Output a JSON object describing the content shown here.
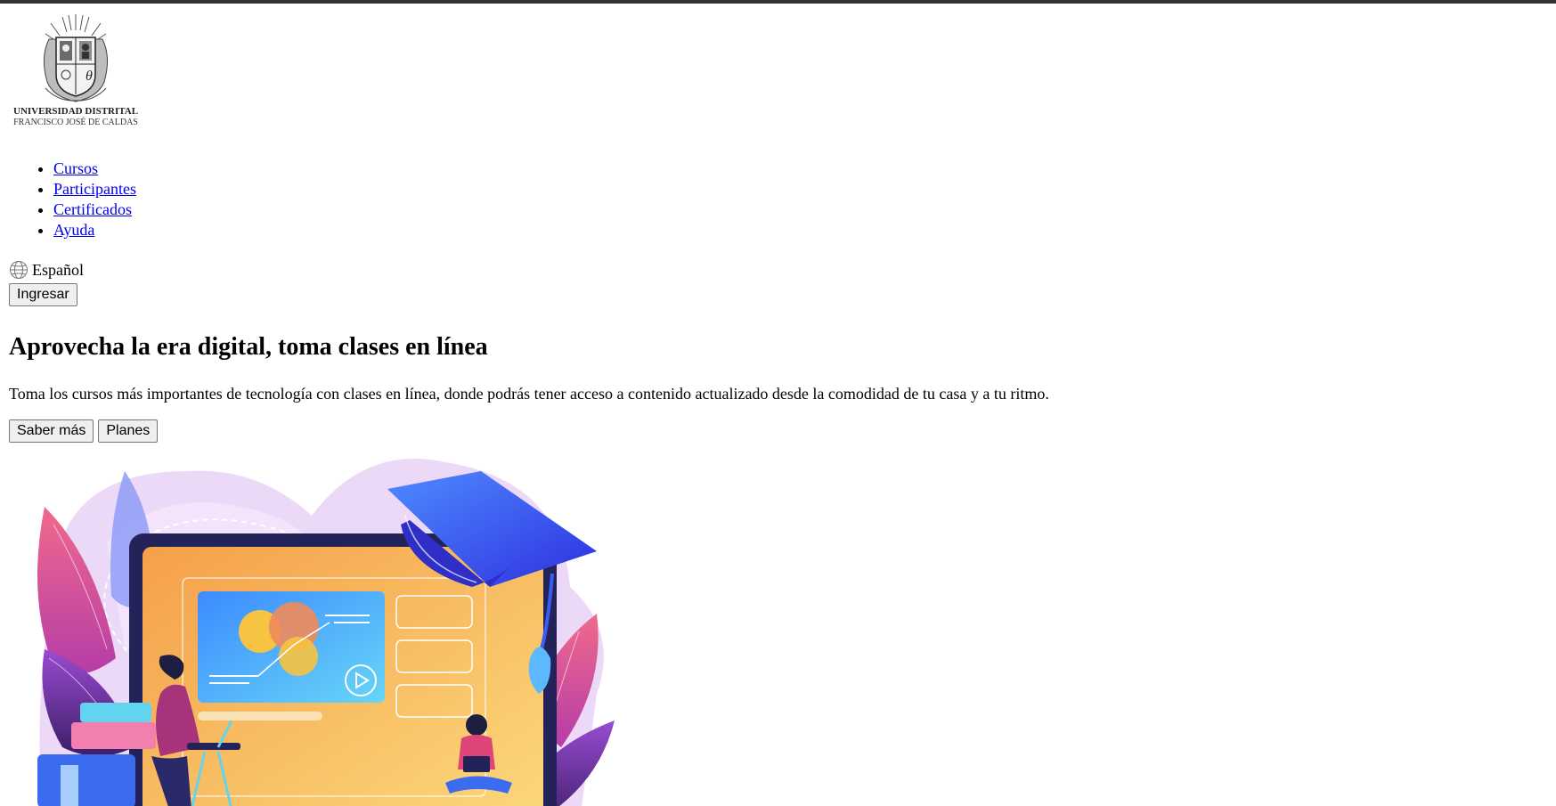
{
  "brand": {
    "logo_line1": "UNIVERSIDAD DISTRITAL",
    "logo_line2": "FRANCISCO JOSÉ DE CALDAS"
  },
  "nav": {
    "items": [
      {
        "label": "Cursos"
      },
      {
        "label": "Participantes"
      },
      {
        "label": "Certificados"
      },
      {
        "label": "Ayuda"
      }
    ]
  },
  "language": {
    "icon": "globe-icon",
    "label": "Español"
  },
  "auth": {
    "login_label": "Ingresar"
  },
  "hero": {
    "title": "Aprovecha la era digital, toma clases en línea",
    "description": "Toma los cursos más importantes de tecnología con clases en línea, donde podrás tener acceso a contenido actualizado desde la comodidad de tu casa y a tu ritmo.",
    "primary_button": "Saber más",
    "secondary_button": "Planes"
  },
  "colors": {
    "link": "#0000ee",
    "topbar": "#333333",
    "cap_blue": "#3b5bf5",
    "laptop_dark": "#23235a",
    "screen_orange": "#f7b55a",
    "leaf_pink": "#e0457a",
    "blob_lavender": "#ecd8f7"
  }
}
